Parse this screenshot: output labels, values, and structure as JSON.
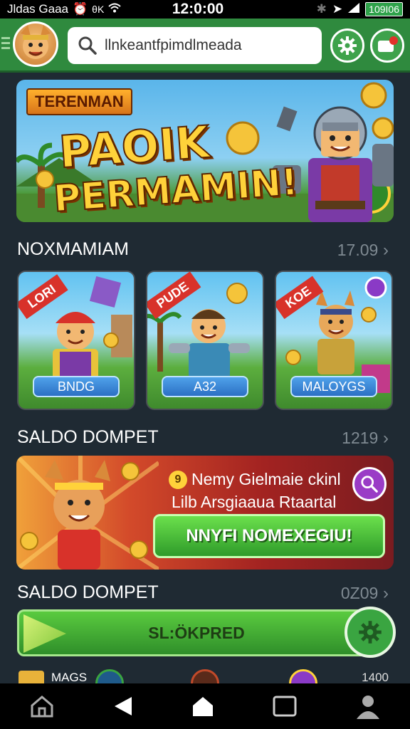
{
  "status_bar": {
    "left_text": "Jldas Gaaa",
    "left_suffix": "θK",
    "time": "12:0:00",
    "battery_text": "109I06"
  },
  "header": {
    "search_placeholder": "llnkeantfpimdlmeada",
    "icons": [
      "menu-icon",
      "avatar",
      "search-icon",
      "gear-icon",
      "notification-icon"
    ]
  },
  "banner": {
    "tag": "TERENMAN",
    "title_line1": "PAOIK",
    "title_line2": "PERMAMIN!"
  },
  "section1": {
    "title": "NOXMAMIAM",
    "count": "17.09",
    "cards": [
      {
        "ribbon": "LORI",
        "label": "BNDG"
      },
      {
        "ribbon": "PUDE",
        "label": "A32"
      },
      {
        "ribbon": "KOE",
        "label": "MALOYGS"
      }
    ]
  },
  "section2": {
    "title": "SALDO DOMPET",
    "count": "1219",
    "promo": {
      "badge": "9",
      "line1": "Nemy Gielmaie ckinl",
      "line2": "Lilb Arsgiaaua Rtaartal",
      "cta": "NNYFI NOMEXEGIU!"
    }
  },
  "section3": {
    "title": "SALDO DOMPET",
    "count": "0Z09",
    "bar_label": "SL:ÖKPRED"
  },
  "bottom_row": {
    "left_label": "MAGS",
    "right_count": "1400"
  },
  "colors": {
    "header_green": "#2f8a3e",
    "background": "#1f2a33",
    "cta_green": "#3aa541"
  }
}
